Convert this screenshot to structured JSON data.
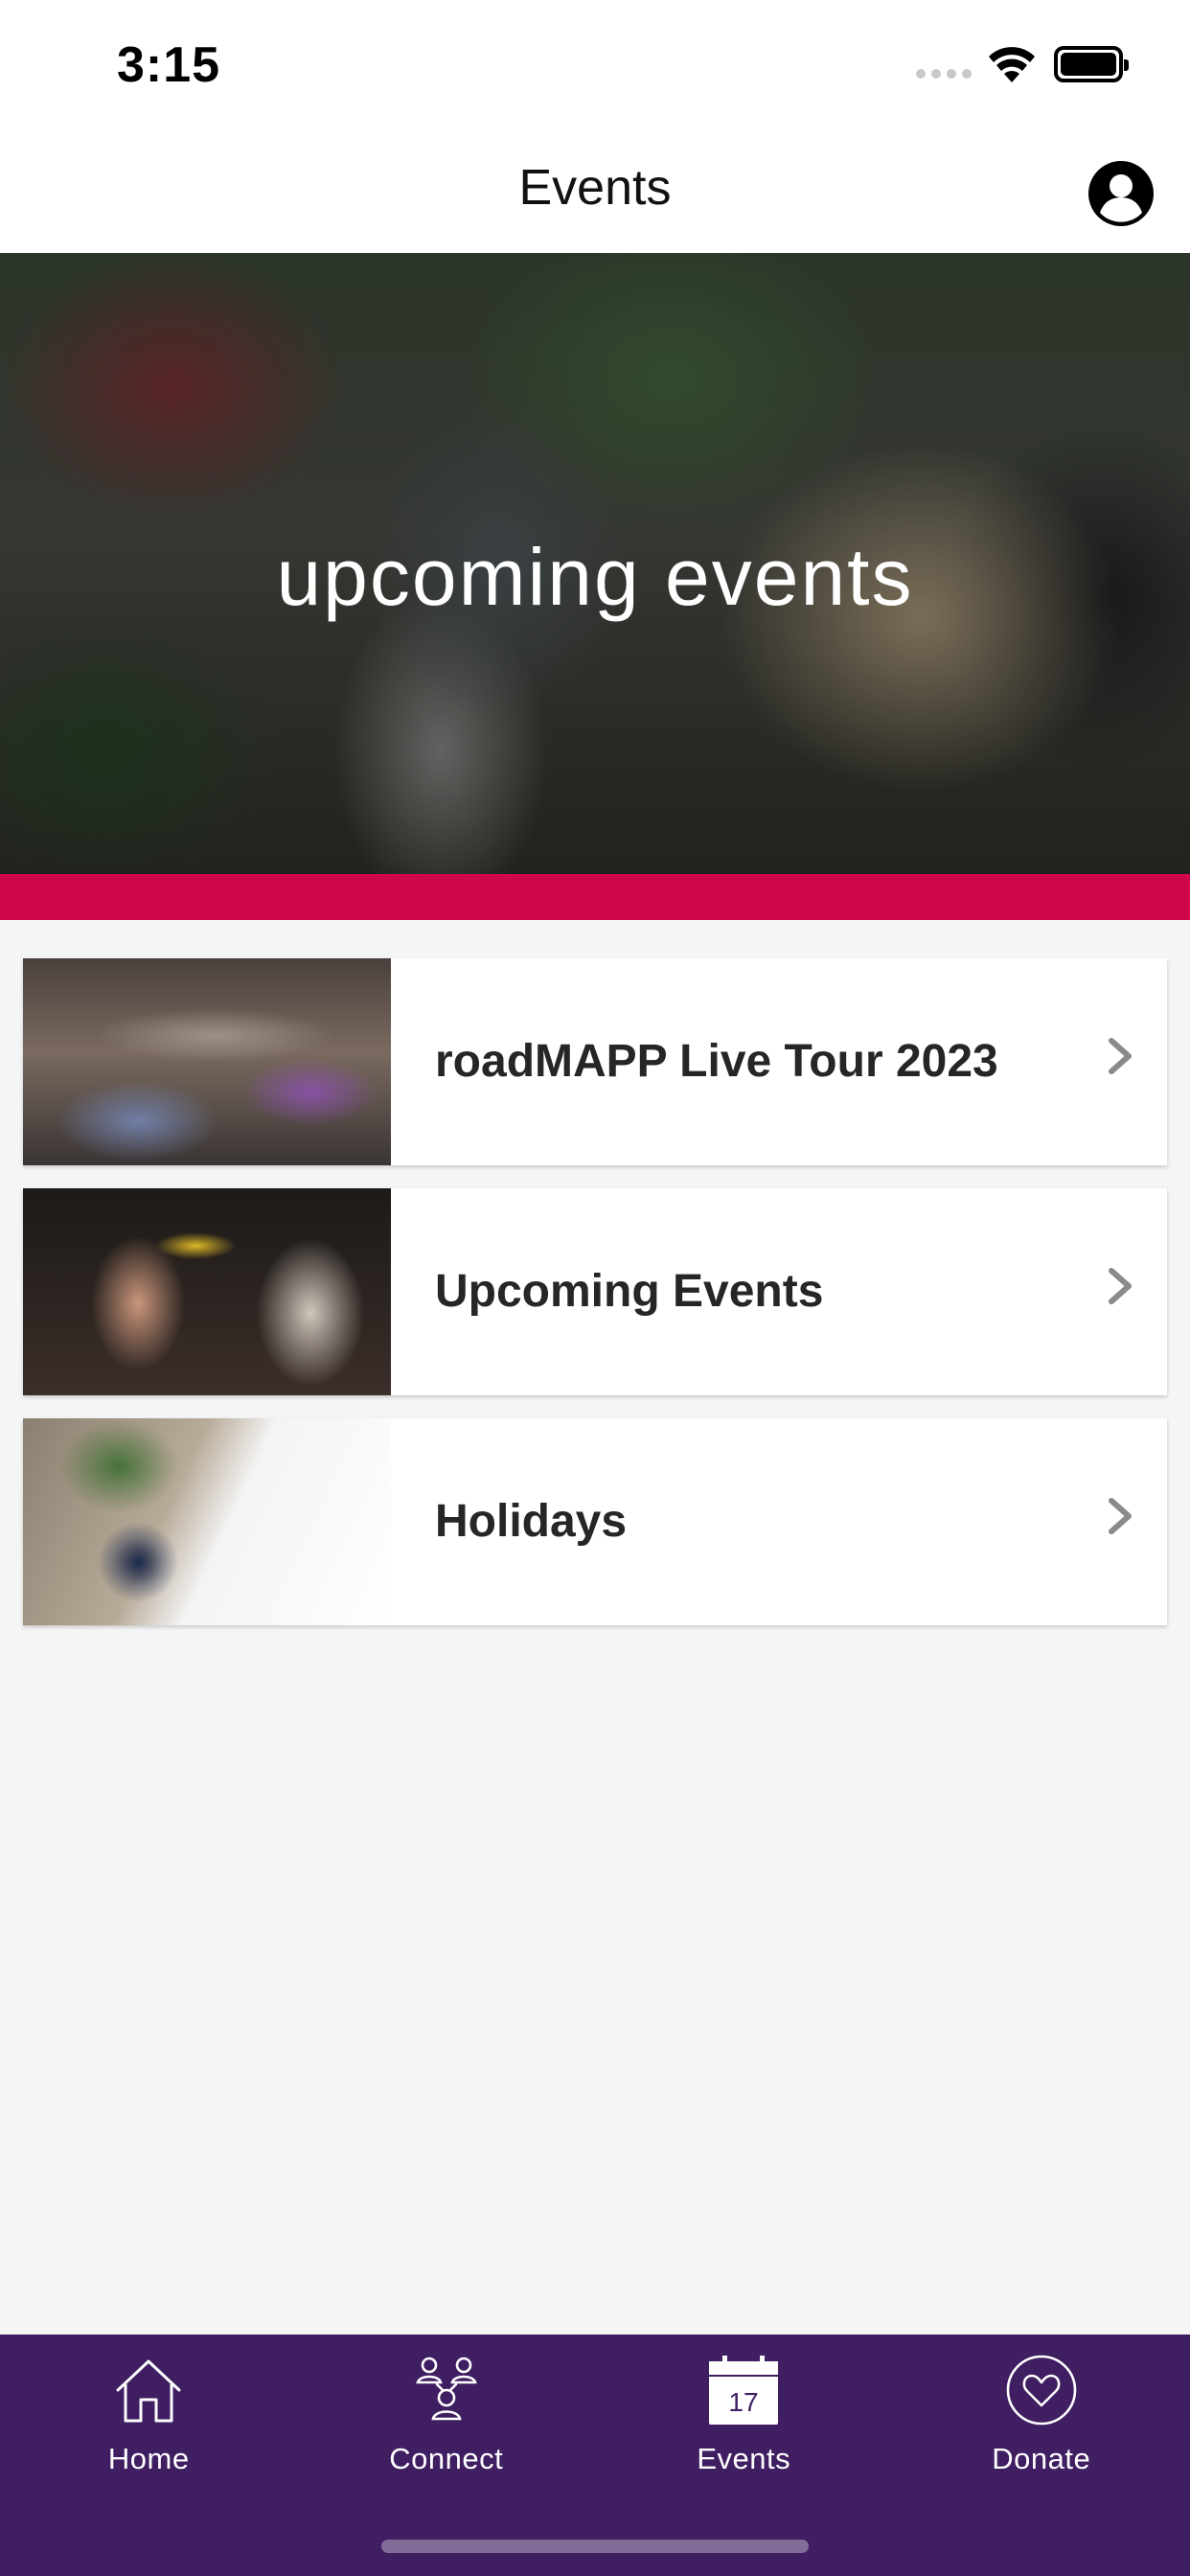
{
  "status_bar": {
    "time": "3:15"
  },
  "header": {
    "title": "Events",
    "profile_icon": "person-circle-icon"
  },
  "hero": {
    "title": "upcoming events",
    "accent_color": "#d0064a"
  },
  "events": [
    {
      "title": "roadMAPP Live Tour 2023",
      "icon": "chevron-right-icon"
    },
    {
      "title": "Upcoming Events",
      "icon": "chevron-right-icon"
    },
    {
      "title": "Holidays",
      "icon": "chevron-right-icon"
    }
  ],
  "tab_bar": {
    "background_color": "#3f1e62",
    "tabs": [
      {
        "label": "Home",
        "icon": "home-icon"
      },
      {
        "label": "Connect",
        "icon": "people-icon"
      },
      {
        "label": "Events",
        "icon": "calendar-icon",
        "calendar_day": "17",
        "selected": true
      },
      {
        "label": "Donate",
        "icon": "heart-icon"
      }
    ]
  }
}
